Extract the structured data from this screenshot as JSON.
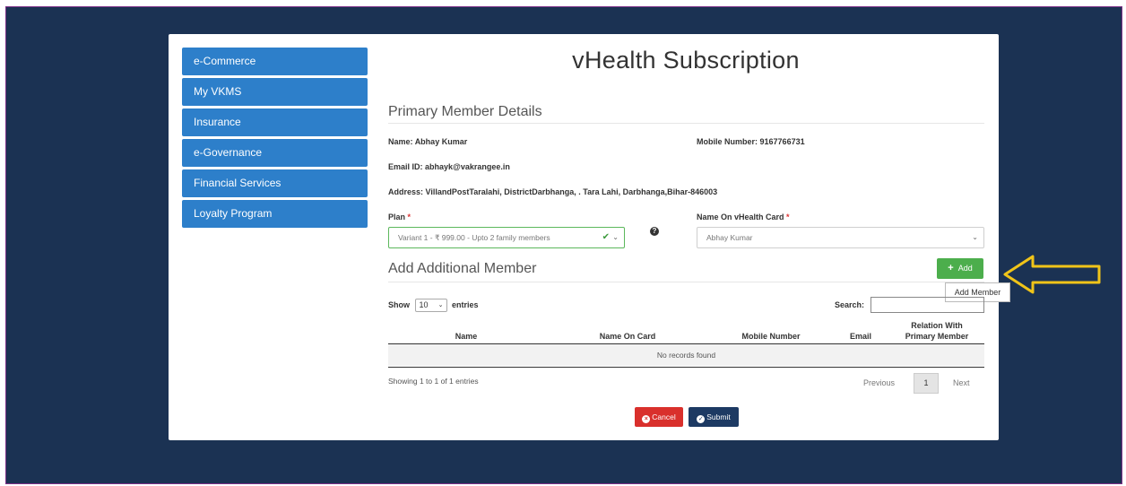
{
  "sidebar": {
    "items": [
      {
        "label": "e-Commerce"
      },
      {
        "label": "My VKMS"
      },
      {
        "label": "Insurance"
      },
      {
        "label": "e-Governance"
      },
      {
        "label": "Financial Services"
      },
      {
        "label": "Loyalty Program"
      }
    ]
  },
  "page": {
    "title": "vHealth Subscription"
  },
  "primary": {
    "heading": "Primary Member Details",
    "name_label": "Name:",
    "name_value": "Abhay Kumar",
    "mobile_label": "Mobile Number:",
    "mobile_value": "9167766731",
    "email_label": "Email ID:",
    "email_value": "abhayk@vakrangee.in",
    "address_label": "Address:",
    "address_value": "VillandPostTaralahi, DistrictDarbhanga, . Tara Lahi, Darbhanga,Bihar-846003"
  },
  "plan": {
    "label": "Plan",
    "required": "*",
    "value": "Variant 1 - ₹ 999.00 - Upto 2 family members"
  },
  "card_name": {
    "label": "Name On vHealth Card",
    "required": "*",
    "value": "Abhay Kumar"
  },
  "additional": {
    "heading": "Add Additional Member",
    "add_label": "Add",
    "tooltip": "Add Member"
  },
  "table": {
    "show_label": "Show",
    "page_size": "10",
    "entries_label": "entries",
    "search_label": "Search:",
    "columns": [
      "Name",
      "Name On Card",
      "Mobile Number",
      "Email",
      "Relation With",
      "Primary Member"
    ],
    "empty_text": "No records found",
    "info": "Showing 1 to 1 of 1 entries",
    "prev_label": "Previous",
    "current_page": "1",
    "next_label": "Next"
  },
  "actions": {
    "cancel_label": "Cancel",
    "submit_label": "Submit"
  },
  "colors": {
    "accent_blue": "#2d7fca",
    "success": "#4cae4c",
    "danger": "#d9302c",
    "navy": "#1d3a63",
    "arrow": "#f0c419"
  }
}
